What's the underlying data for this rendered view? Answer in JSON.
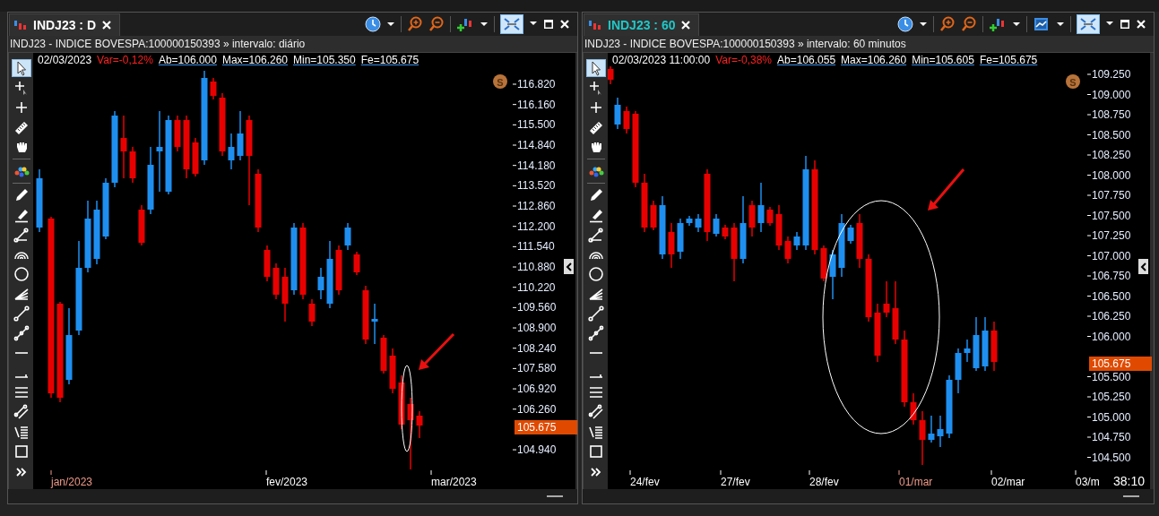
{
  "panels": [
    {
      "tab": {
        "title": "INDJ23 : D",
        "focused": false
      },
      "fit_selected": true,
      "caption": "INDJ23 - INDICE BOVESPA:100000150393 » intervalo: diário",
      "quote": {
        "date": "02/03/2023",
        "variation": "Var=-0,12%",
        "fields": [
          "Ab=106.000",
          "Max=106.260",
          "Min=105.350",
          "Fe=105.675"
        ]
      },
      "badge": "S",
      "price_axis": [
        "116.820",
        "116.160",
        "115.500",
        "114.840",
        "114.180",
        "113.520",
        "112.860",
        "112.200",
        "111.540",
        "110.880",
        "110.220",
        "109.560",
        "108.900",
        "108.240",
        "107.580",
        "106.920",
        "106.260",
        "104.940"
      ],
      "last_price": "105.675",
      "dates": [
        {
          "label": "jan/2023",
          "color": "#f09a88"
        },
        {
          "label": "fev/2023",
          "color": "#ffffff"
        },
        {
          "label": "mar/2023",
          "color": "#ffffff"
        }
      ],
      "tools": [
        {
          "kind": "pointer",
          "selected": true
        },
        {
          "kind": "crosshair",
          "selected": false
        },
        {
          "kind": "plus",
          "selected": false
        },
        {
          "kind": "ruler",
          "selected": false
        },
        {
          "kind": "hand",
          "selected": false
        },
        {
          "kind": "palette",
          "selected": false
        },
        {
          "kind": "pencil",
          "selected": false
        },
        {
          "kind": "marker",
          "selected": false
        },
        {
          "kind": "angle",
          "selected": false
        },
        {
          "kind": "arcs",
          "selected": false
        },
        {
          "kind": "circle",
          "selected": false
        },
        {
          "kind": "fan",
          "selected": false
        },
        {
          "kind": "line",
          "selected": false
        },
        {
          "kind": "polyline",
          "selected": false
        },
        {
          "kind": "hline",
          "selected": false
        },
        {
          "kind": "ray",
          "selected": false
        },
        {
          "kind": "lines",
          "selected": false
        },
        {
          "kind": "channel",
          "selected": false
        },
        {
          "kind": "fib",
          "selected": false
        },
        {
          "kind": "rectangle",
          "selected": false
        }
      ]
    },
    {
      "tab": {
        "title": "INDJ23 : 60",
        "focused": true
      },
      "template_menu": true,
      "fit_selected": true,
      "caption": "INDJ23 - INDICE BOVESPA:100000150393 » intervalo: 60 minutos",
      "quote": {
        "date": "02/03/2023 11:00:00",
        "variation": "Var=-0,38%",
        "fields": [
          "Ab=106.055",
          "Max=106.260",
          "Min=105.605",
          "Fe=105.675"
        ]
      },
      "badge": "S",
      "price_axis": [
        "109.250",
        "109.000",
        "108.750",
        "108.500",
        "108.250",
        "108.000",
        "107.750",
        "107.500",
        "107.250",
        "107.000",
        "106.750",
        "106.500",
        "106.250",
        "106.000",
        "105.500",
        "105.250",
        "105.000",
        "104.750",
        "104.500"
      ],
      "last_price": "105.675",
      "dates": [
        {
          "label": "24/fev",
          "color": "#ffffff"
        },
        {
          "label": "27/fev",
          "color": "#ffffff"
        },
        {
          "label": "28/fev",
          "color": "#ffffff"
        },
        {
          "label": "01/mar",
          "color": "#f09a88"
        },
        {
          "label": "02/mar",
          "color": "#ffffff"
        },
        {
          "label": "03/m",
          "color": "#ffffff"
        }
      ],
      "countdown": "38:10",
      "tools": [
        {
          "kind": "pointer",
          "selected": true
        },
        {
          "kind": "crosshair",
          "selected": false
        },
        {
          "kind": "plus",
          "selected": false
        },
        {
          "kind": "ruler",
          "selected": false
        },
        {
          "kind": "hand",
          "selected": false
        },
        {
          "kind": "palette",
          "selected": false
        },
        {
          "kind": "pencil",
          "selected": false
        },
        {
          "kind": "marker",
          "selected": false
        },
        {
          "kind": "angle",
          "selected": false
        },
        {
          "kind": "arcs",
          "selected": false
        },
        {
          "kind": "circle",
          "selected": false
        },
        {
          "kind": "fan",
          "selected": false
        },
        {
          "kind": "line",
          "selected": false
        },
        {
          "kind": "polyline",
          "selected": false
        },
        {
          "kind": "hline",
          "selected": false
        },
        {
          "kind": "ray",
          "selected": false
        },
        {
          "kind": "lines",
          "selected": false
        },
        {
          "kind": "channel",
          "selected": false
        },
        {
          "kind": "fib",
          "selected": false
        },
        {
          "kind": "rectangle",
          "selected": false
        }
      ]
    }
  ]
}
